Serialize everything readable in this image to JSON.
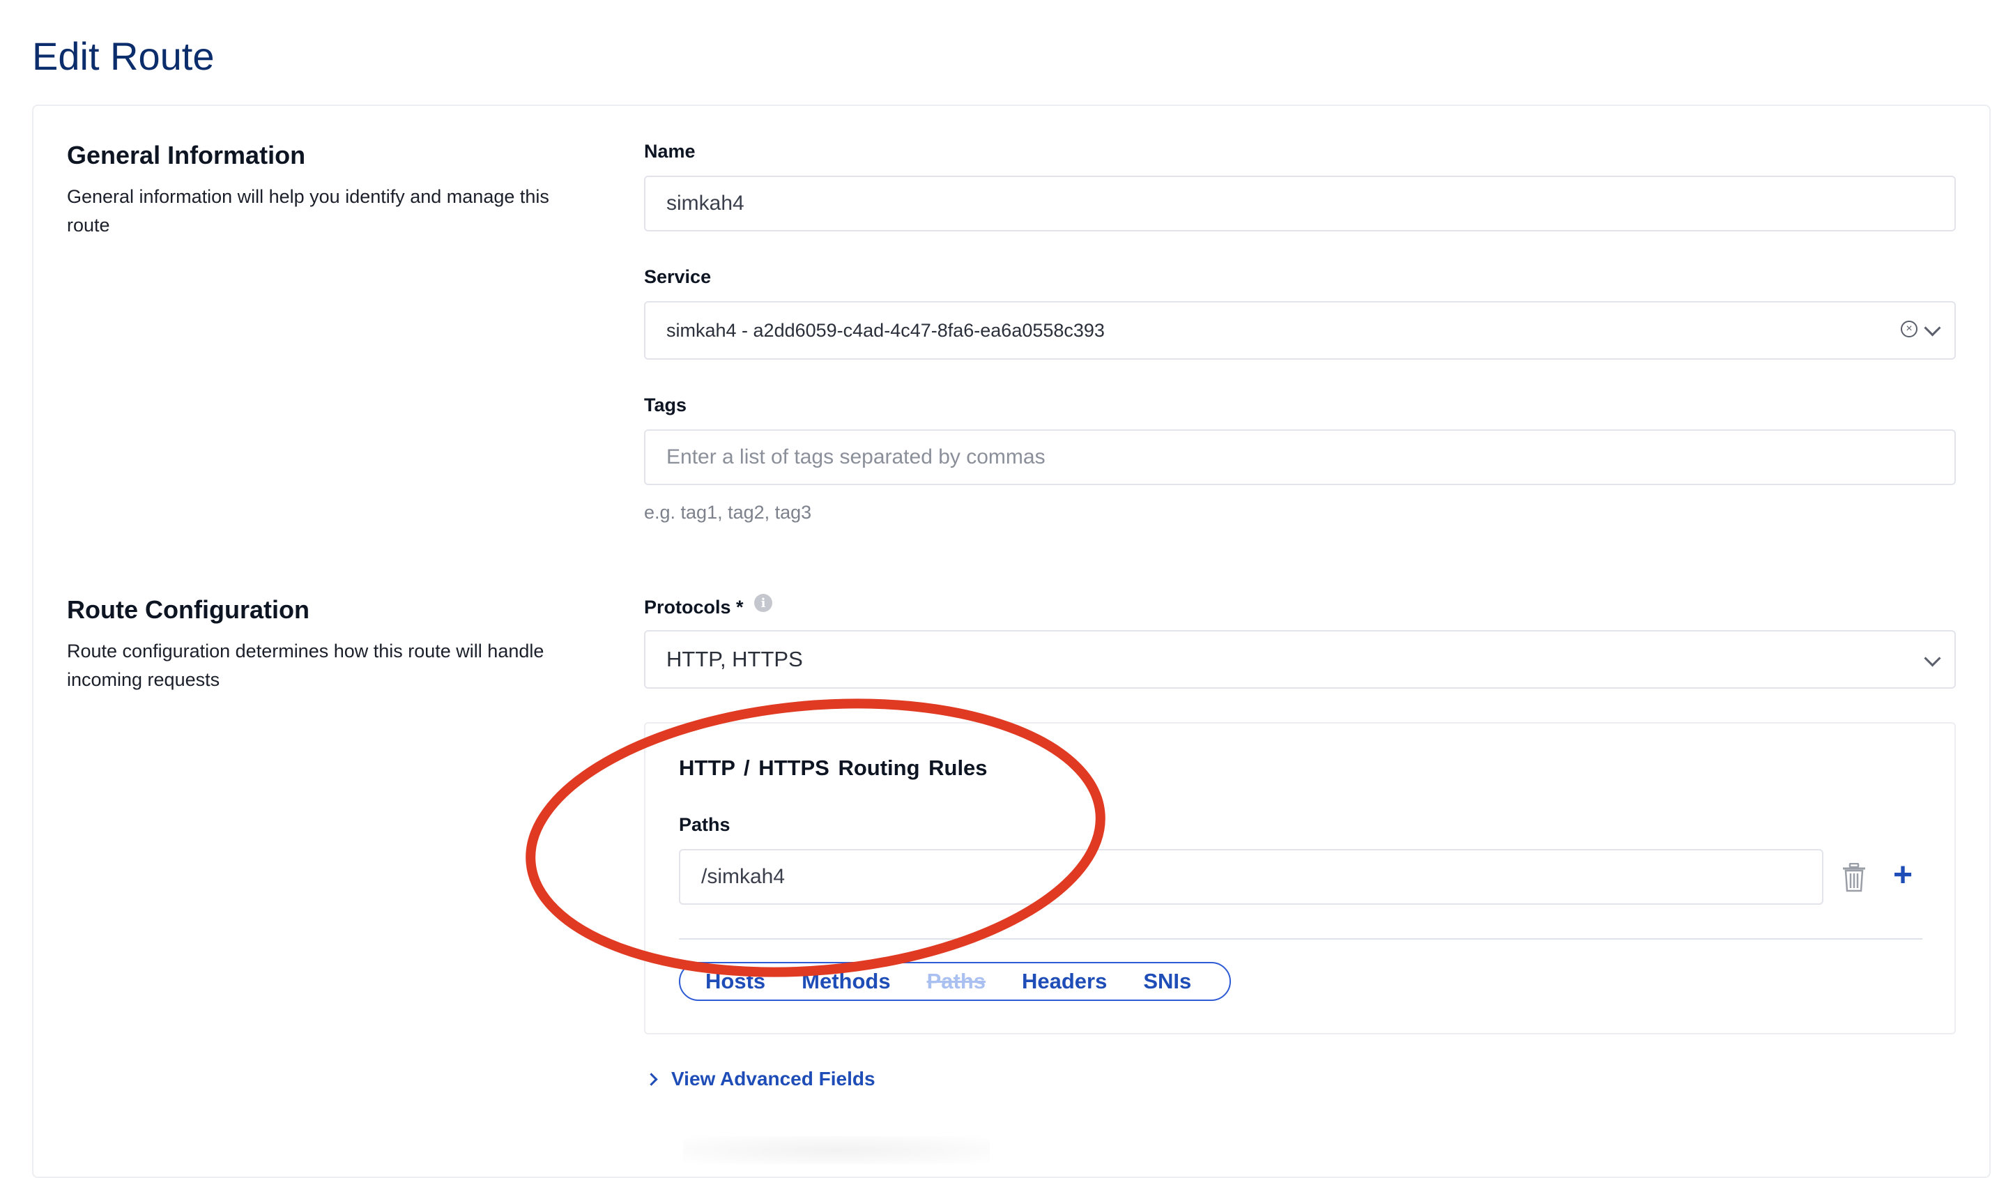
{
  "page": {
    "title": "Edit Route"
  },
  "general": {
    "title": "General Information",
    "description": "General information will help you identify and manage this route"
  },
  "name_field": {
    "label": "Name",
    "value": "simkah4"
  },
  "service_field": {
    "label": "Service",
    "value": "simkah4 - a2dd6059-c4ad-4c47-8fa6-ea6a0558c393"
  },
  "tags_field": {
    "label": "Tags",
    "placeholder": "Enter a list of tags separated by commas",
    "hint": "e.g. tag1, tag2, tag3"
  },
  "route_config": {
    "title": "Route Configuration",
    "description": "Route configuration determines how this route will handle incoming requests"
  },
  "protocols_field": {
    "label": "Protocols *",
    "info_icon": "i",
    "value": "HTTP, HTTPS"
  },
  "routing_rules": {
    "title": "HTTP / HTTPS Routing Rules",
    "paths_label": "Paths",
    "path_value": "/simkah4",
    "tabs": [
      {
        "label": "Hosts",
        "disabled": false
      },
      {
        "label": "Methods",
        "disabled": false
      },
      {
        "label": "Paths",
        "disabled": true
      },
      {
        "label": "Headers",
        "disabled": false
      },
      {
        "label": "SNIs",
        "disabled": false
      }
    ],
    "add_symbol": "+"
  },
  "advanced": {
    "label": "View Advanced Fields"
  },
  "colors": {
    "title": "#0b2d6b",
    "link": "#1f4db8",
    "annotation": "#e03a22",
    "border": "#e2e4ea"
  },
  "icons": [
    "clear-icon",
    "chevron-down-icon",
    "info-icon",
    "trash-icon",
    "plus-icon",
    "chevron-right-icon"
  ]
}
